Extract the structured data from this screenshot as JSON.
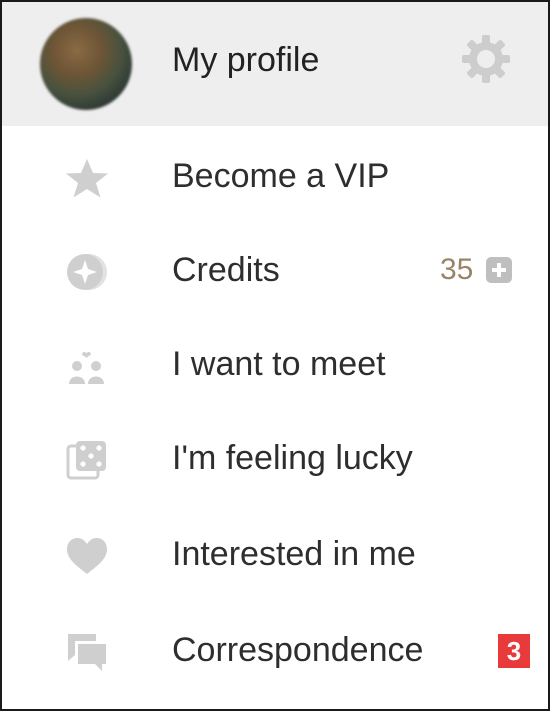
{
  "profile": {
    "label": "My profile",
    "avatar_icon": "avatar",
    "settings_icon": "gear-icon"
  },
  "menu": {
    "items": [
      {
        "label": "Become a VIP",
        "icon": "star-icon"
      },
      {
        "label": "Credits",
        "icon": "coin-icon",
        "count": "35",
        "action_icon": "plus-icon"
      },
      {
        "label": "I want to meet",
        "icon": "couple-icon"
      },
      {
        "label": "I'm feeling lucky",
        "icon": "dice-icon"
      },
      {
        "label": "Interested in me",
        "icon": "heart-icon"
      },
      {
        "label": "Correspondence",
        "icon": "chat-icon",
        "badge": "3"
      }
    ]
  },
  "colors": {
    "icon": "#cfcfcf",
    "header_bg": "#eeeeee",
    "badge": "#e83a3a",
    "credits_text": "#9a8468"
  }
}
